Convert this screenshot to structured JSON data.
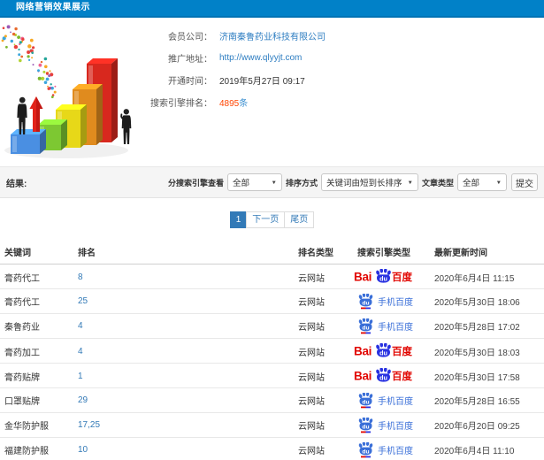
{
  "titlebar": {
    "title": "网络营销效果展示",
    "color": "#0181c8"
  },
  "info": {
    "fields": [
      {
        "label": "会员公司：",
        "value": "济南秦鲁药业科技有限公司",
        "kind": "link"
      },
      {
        "label": "推广地址：",
        "value": "http://www.qlyyjt.com",
        "kind": "link"
      },
      {
        "label": "开通时间：",
        "value": "2019年5月27日 09:17",
        "kind": "plain"
      },
      {
        "label": "搜索引擎排名：",
        "value": "4895",
        "suffix": "条",
        "kind": "count"
      }
    ]
  },
  "filters": {
    "results_label": "结果:",
    "engine_label": "分搜索引擎查看",
    "engine_value": "全部",
    "sort_label": "排序方式",
    "sort_value": "关键词由短到长排序",
    "article_label": "文章类型",
    "article_value": "全部",
    "submit_label": "提交"
  },
  "pagination": {
    "current": "1",
    "next": "下一页",
    "last": "尾页"
  },
  "table": {
    "headers": [
      "关键词",
      "排名",
      "排名类型",
      "搜索引擎类型",
      "最新更新时间"
    ],
    "rows": [
      {
        "keyword": "膏药代工",
        "rank": "8",
        "rank_type": "云网站",
        "engine": "百度",
        "time": "2020年6月4日 11:15"
      },
      {
        "keyword": "膏药代工",
        "rank": "25",
        "rank_type": "云网站",
        "engine": "手机百度",
        "time": "2020年5月30日 18:06"
      },
      {
        "keyword": "秦鲁药业",
        "rank": "4",
        "rank_type": "云网站",
        "engine": "手机百度",
        "time": "2020年5月28日 17:02"
      },
      {
        "keyword": "膏药加工",
        "rank": "4",
        "rank_type": "云网站",
        "engine": "百度",
        "time": "2020年5月30日 18:03"
      },
      {
        "keyword": "膏药贴牌",
        "rank": "1",
        "rank_type": "云网站",
        "engine": "百度",
        "time": "2020年5月30日 17:58"
      },
      {
        "keyword": "口罩贴牌",
        "rank": "29",
        "rank_type": "云网站",
        "engine": "手机百度",
        "time": "2020年5月28日 16:55"
      },
      {
        "keyword": "金华防护服",
        "rank": "17,25",
        "rank_type": "云网站",
        "engine": "手机百度",
        "time": "2020年6月20日 09:25"
      },
      {
        "keyword": "福建防护服",
        "rank": "10",
        "rank_type": "云网站",
        "engine": "手机百度",
        "time": "2020年6月4日 11:10"
      }
    ]
  },
  "logos": {
    "baidu": {
      "bai": "Bai",
      "du": "du",
      "cn": "百度",
      "red": "#e10601",
      "blue": "#2932e1"
    },
    "mobile": {
      "text": "手机百度",
      "blue": "#3a6fd8"
    }
  },
  "illustration_colors": [
    "#4a8fe2",
    "#7dc832",
    "#e7d818",
    "#e08b1e",
    "#d8281e"
  ]
}
